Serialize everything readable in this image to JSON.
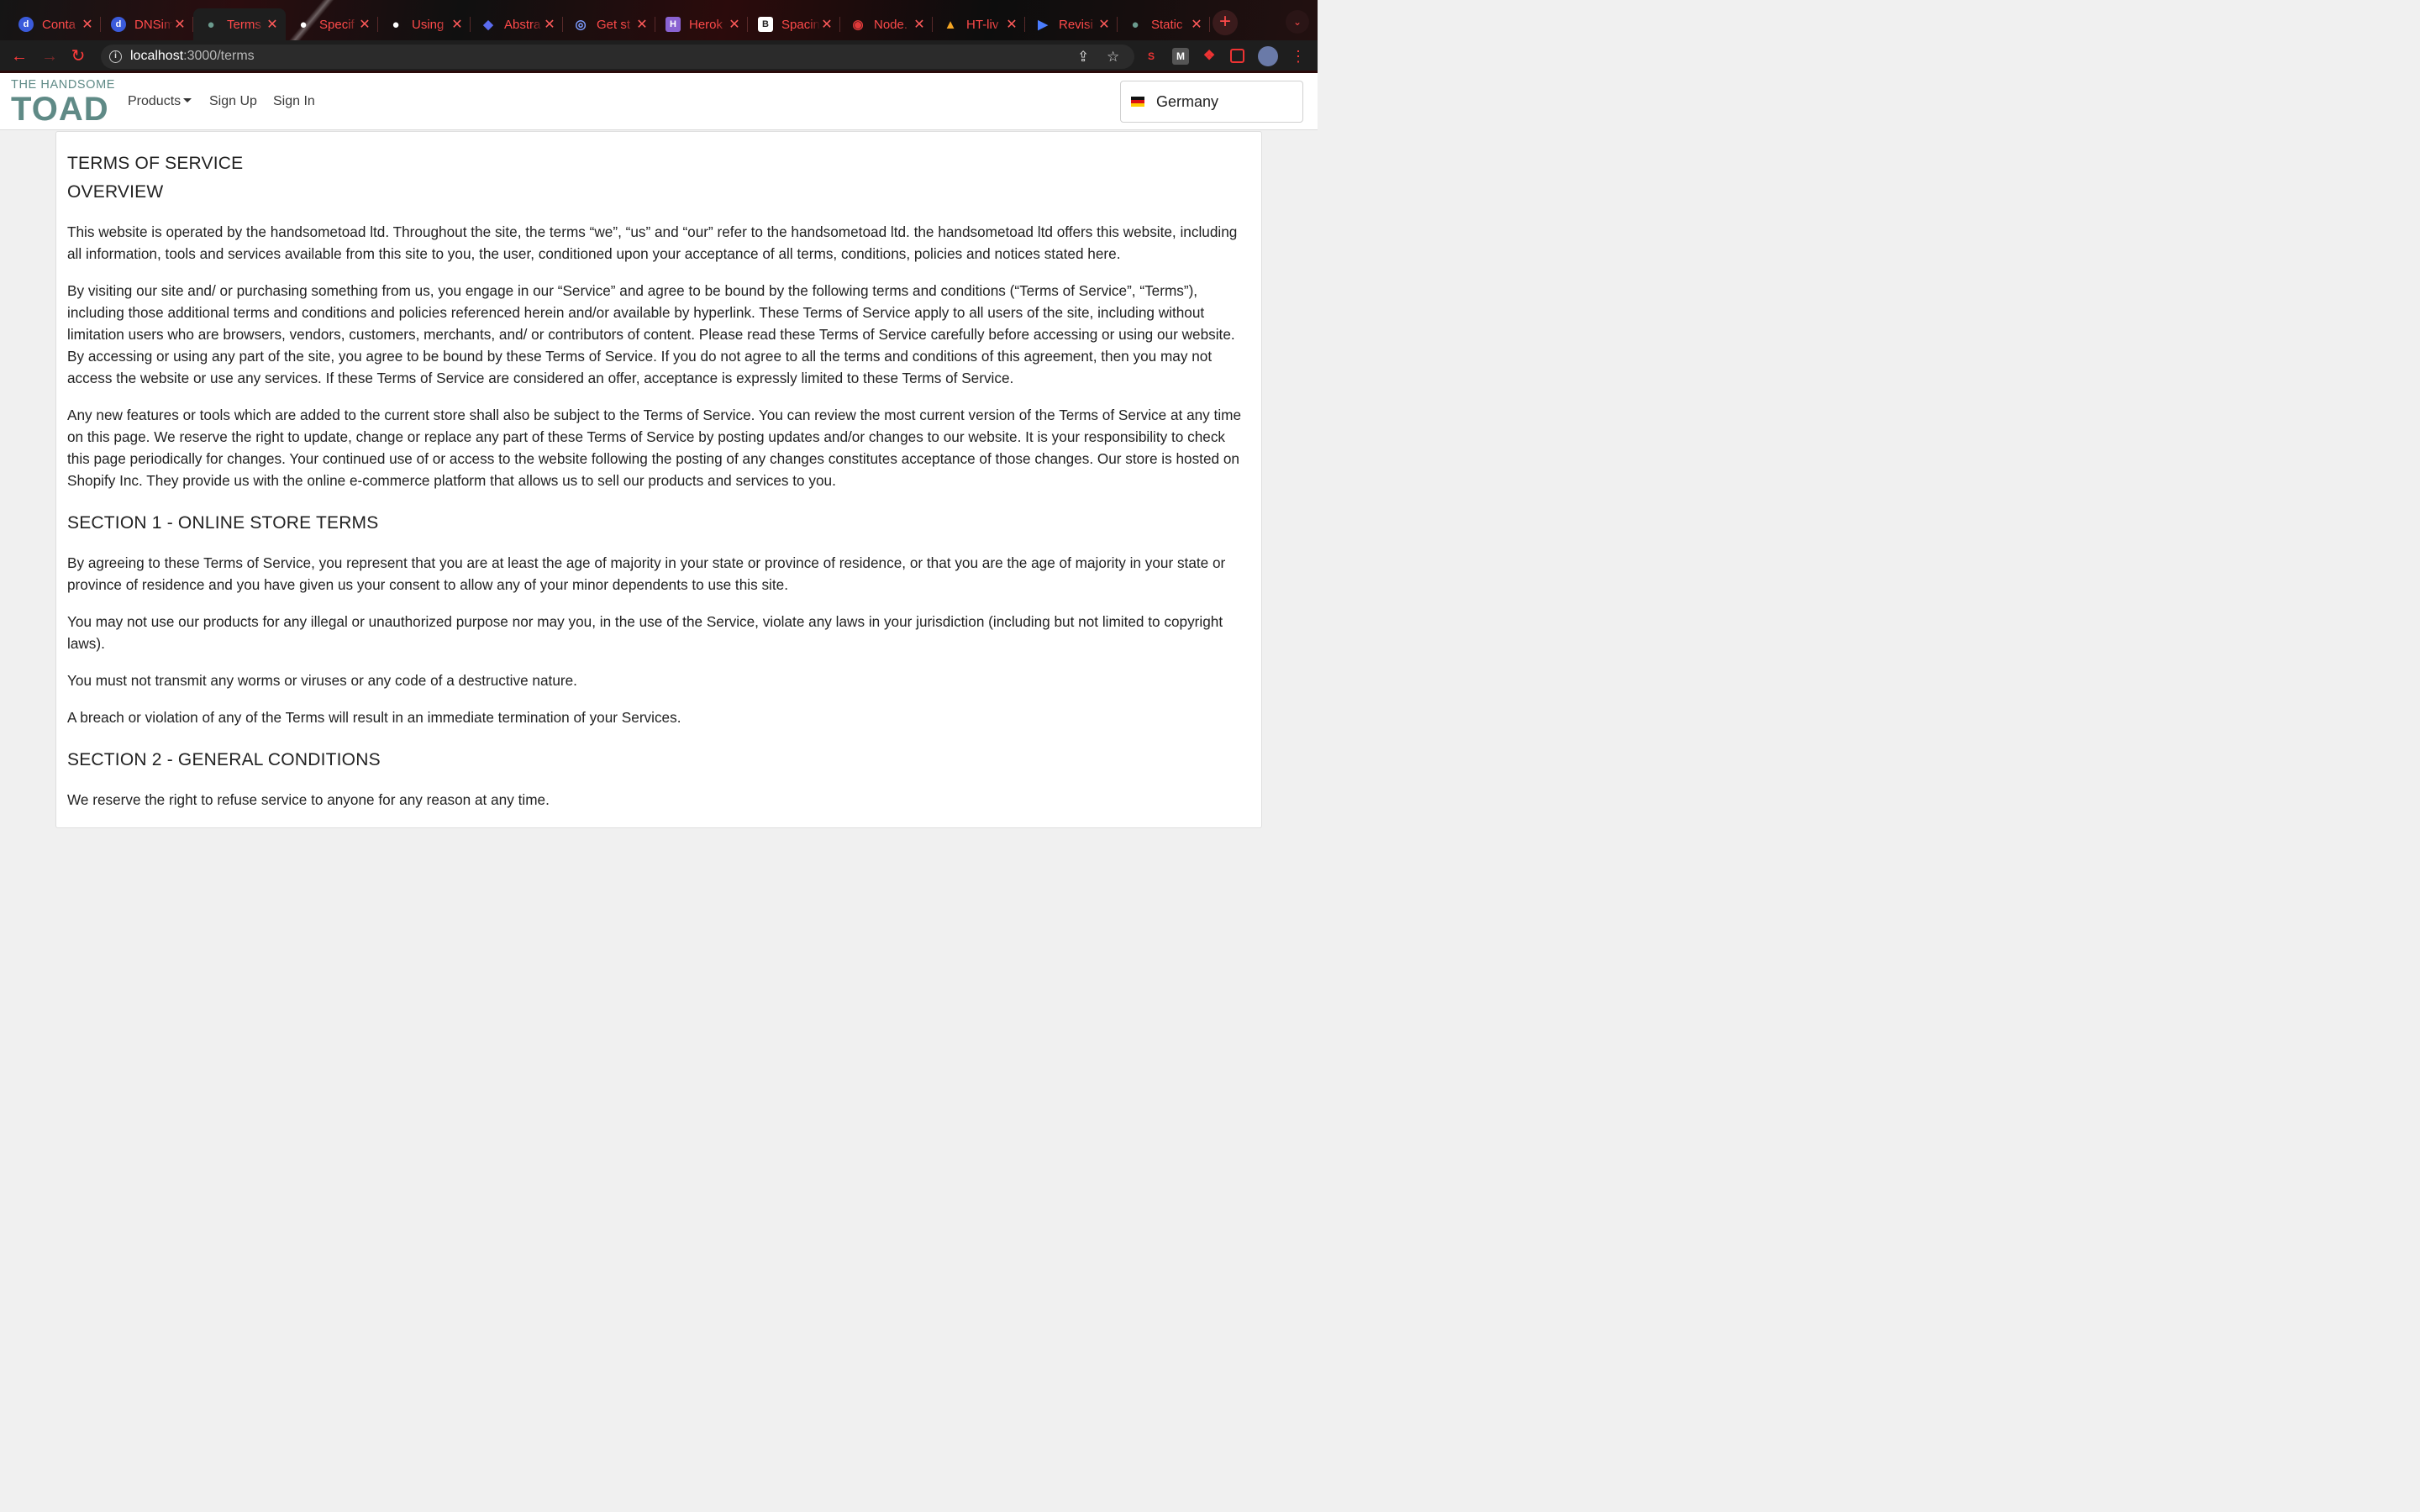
{
  "browser": {
    "tabs": [
      {
        "title": "Conta",
        "favicon": "d",
        "favicon_color": "#3b5bdb"
      },
      {
        "title": "DNSim",
        "favicon": "d",
        "favicon_color": "#3b5bdb"
      },
      {
        "title": "Terms",
        "favicon": "toad",
        "favicon_color": "#6b9b8e",
        "active": true
      },
      {
        "title": "Specif",
        "favicon": "google-cloud",
        "favicon_color": "#ffffff"
      },
      {
        "title": "Using",
        "favicon": "google-cloud",
        "favicon_color": "#ffffff"
      },
      {
        "title": "Abstra",
        "favicon": "diamond",
        "favicon_color": "#5b6cf0"
      },
      {
        "title": "Get st",
        "favicon": "target",
        "favicon_color": "#7c9cff"
      },
      {
        "title": "Herok",
        "favicon": "H",
        "favicon_color": "#8a63d2"
      },
      {
        "title": "Spacin",
        "favicon": "B",
        "favicon_color": "#ffffff"
      },
      {
        "title": "Node.",
        "favicon": "globe",
        "favicon_color": "#e03a3a"
      },
      {
        "title": "HT-liv",
        "favicon": "flame",
        "favicon_color": "#f5a623"
      },
      {
        "title": "Revisi",
        "favicon": "play",
        "favicon_color": "#4a7dff"
      },
      {
        "title": "Static",
        "favicon": "toad",
        "favicon_color": "#6b9b8e"
      }
    ],
    "new_tab_symbol": "+",
    "url_host": "localhost",
    "url_path": ":3000/terms"
  },
  "site": {
    "logo_top": "THE HANDSOME",
    "logo_bottom": "TOAD",
    "nav": {
      "products": "Products",
      "sign_up": "Sign Up",
      "sign_in": "Sign In"
    },
    "country": "Germany"
  },
  "terms": {
    "title": "TERMS OF SERVICE",
    "overview_heading": "OVERVIEW",
    "overview_paragraphs": [
      "This website is operated by the handsometoad ltd. Throughout the site, the terms “we”, “us” and “our” refer to the handsometoad ltd. the handsometoad ltd offers this website, including all information, tools and services available from this site to you, the user, conditioned upon your acceptance of all terms, conditions, policies and notices stated here.",
      "By visiting our site and/ or purchasing something from us, you engage in our “Service” and agree to be bound by the following terms and conditions (“Terms of Service”, “Terms”), including those additional terms and conditions and policies referenced herein and/or available by hyperlink. These Terms of Service apply to all users of the site, including without limitation users who are browsers, vendors, customers, merchants, and/ or contributors of content. Please read these Terms of Service carefully before accessing or using our website. By accessing or using any part of the site, you agree to be bound by these Terms of Service. If you do not agree to all the terms and conditions of this agreement, then you may not access the website or use any services. If these Terms of Service are considered an offer, acceptance is expressly limited to these Terms of Service.",
      "Any new features or tools which are added to the current store shall also be subject to the Terms of Service. You can review the most current version of the Terms of Service at any time on this page. We reserve the right to update, change or replace any part of these Terms of Service by posting updates and/or changes to our website. It is your responsibility to check this page periodically for changes. Your continued use of or access to the website following the posting of any changes constitutes acceptance of those changes. Our store is hosted on Shopify Inc. They provide us with the online e-commerce platform that allows us to sell our products and services to you."
    ],
    "section1_heading": "SECTION 1 - ONLINE STORE TERMS",
    "section1_paragraphs": [
      "By agreeing to these Terms of Service, you represent that you are at least the age of majority in your state or province of residence, or that you are the age of majority in your state or province of residence and you have given us your consent to allow any of your minor dependents to use this site.",
      "You may not use our products for any illegal or unauthorized purpose nor may you, in the use of the Service, violate any laws in your jurisdiction (including but not limited to copyright laws).",
      "You must not transmit any worms or viruses or any code of a destructive nature.",
      "A breach or violation of any of the Terms will result in an immediate termination of your Services."
    ],
    "section2_heading": "SECTION 2 - GENERAL CONDITIONS",
    "section2_paragraphs": [
      "We reserve the right to refuse service to anyone for any reason at any time."
    ]
  }
}
